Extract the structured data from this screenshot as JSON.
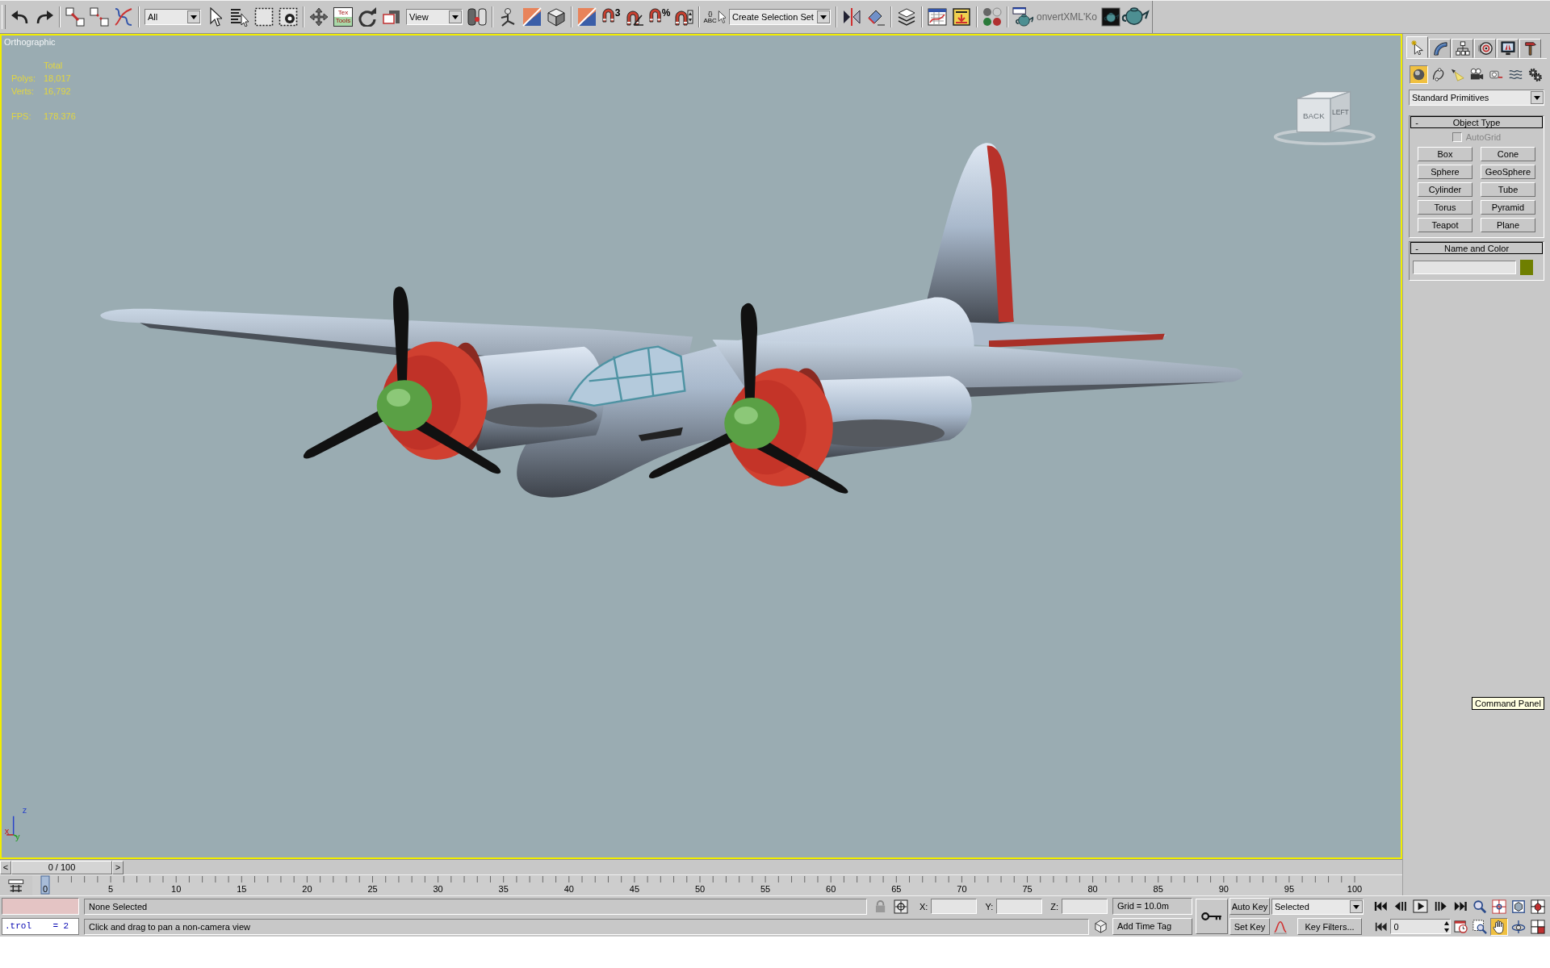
{
  "toolbar": {
    "groups": [
      [
        {
          "kind": "undo"
        },
        {
          "kind": "redo"
        }
      ],
      [
        {
          "kind": "link"
        },
        {
          "kind": "unlink"
        },
        {
          "kind": "bind"
        }
      ],
      [
        {
          "kind": "filter_dropdown",
          "value": "All"
        },
        {
          "kind": "select"
        },
        {
          "kind": "select_by_name"
        },
        {
          "kind": "rect_region"
        },
        {
          "kind": "window_crossing"
        }
      ],
      [
        {
          "kind": "move"
        },
        {
          "kind": "texttools",
          "label": "Tex Tools"
        },
        {
          "kind": "rotate"
        },
        {
          "kind": "scale"
        },
        {
          "kind": "coord_dropdown",
          "value": "View"
        },
        {
          "kind": "pivot"
        }
      ],
      [
        {
          "kind": "manipulate"
        },
        {
          "kind": "shortcut"
        },
        {
          "kind": "box3d"
        }
      ],
      [
        {
          "kind": "snap"
        },
        {
          "kind": "magnet_snap",
          "label": "3"
        },
        {
          "kind": "angle_snap"
        },
        {
          "kind": "magnet_snap",
          "label": "%"
        },
        {
          "kind": "spinner_snap"
        }
      ],
      [
        {
          "kind": "named_sel",
          "label": "{} ABC"
        },
        {
          "kind": "selset_dropdown",
          "value": "Create Selection Set"
        }
      ],
      [
        {
          "kind": "mirror"
        },
        {
          "kind": "align"
        }
      ],
      [
        {
          "kind": "layers"
        }
      ],
      [
        {
          "kind": "curve_editor"
        },
        {
          "kind": "schematic"
        }
      ],
      [
        {
          "kind": "material"
        }
      ],
      [
        {
          "kind": "render_setup"
        },
        {
          "kind": "text_label",
          "label": "onvertXML'Ko"
        },
        {
          "kind": "render_frame"
        },
        {
          "kind": "quick_render"
        }
      ]
    ]
  },
  "viewport": {
    "label": "Orthographic",
    "active": true,
    "stats": {
      "header": "Total",
      "rows": [
        {
          "label": "Polys:",
          "value": "18,017"
        },
        {
          "label": "Verts:",
          "value": "16,792"
        }
      ],
      "fps": {
        "label": "FPS:",
        "value": "178.376"
      }
    },
    "view_cube": {
      "face": "BACK",
      "side": "LEFT"
    },
    "axes": [
      {
        "kind": "z",
        "label": "z"
      },
      {
        "kind": "x",
        "label": "x"
      },
      {
        "kind": "y",
        "label": "y"
      }
    ]
  },
  "command_panel": {
    "tabs": [
      {
        "kind": "create",
        "selected": true
      },
      {
        "kind": "modify",
        "selected": false
      },
      {
        "kind": "hierarchy",
        "selected": false
      },
      {
        "kind": "motion",
        "selected": false
      },
      {
        "kind": "display",
        "selected": false
      },
      {
        "kind": "utilities",
        "selected": false
      }
    ],
    "categories": [
      {
        "kind": "geometry",
        "selected": true
      },
      {
        "kind": "shapes",
        "selected": false
      },
      {
        "kind": "lights",
        "selected": false
      },
      {
        "kind": "cameras",
        "selected": false
      },
      {
        "kind": "helpers",
        "selected": false
      },
      {
        "kind": "spacewarps",
        "selected": false
      },
      {
        "kind": "systems",
        "selected": false
      }
    ],
    "type_dropdown": "Standard Primitives",
    "object_type": {
      "sign": "-",
      "title": "Object Type",
      "autogrid": {
        "label": "AutoGrid",
        "checked": false,
        "disabled": true
      },
      "buttons": [
        "Box",
        "Cone",
        "Sphere",
        "GeoSphere",
        "Cylinder",
        "Tube",
        "Torus",
        "Pyramid",
        "Teapot",
        "Plane"
      ]
    },
    "name_and_color": {
      "sign": "-",
      "title": "Name and Color",
      "color": "#6f7f00"
    }
  },
  "tooltip": "Command Panel",
  "time_slider": {
    "prev": "<",
    "position": "0 / 100",
    "next": ">",
    "level": 0
  },
  "track_bar": {
    "labels": [
      "0",
      "5",
      "10",
      "15",
      "20",
      "25",
      "30",
      "35",
      "40",
      "45",
      "50",
      "55",
      "60",
      "65",
      "70",
      "75",
      "80",
      "85",
      "90",
      "95",
      "100"
    ]
  },
  "status_bar": {
    "listener_output": ".trol    = 2",
    "selection": "None Selected",
    "prompt": "Click and drag to pan a non-camera view",
    "coords": [
      {
        "label": "X:"
      },
      {
        "label": "Y:"
      },
      {
        "label": "Z:"
      }
    ],
    "grid": "Grid = 10.0m",
    "time_tag": "Add Time Tag",
    "auto_key": {
      "label": "Auto Key",
      "on": false
    },
    "set_key": "Set Key",
    "key_set": "Selected",
    "key_filters": "Key Filters...",
    "frame": "0",
    "playback": [
      {
        "kind": "go_start"
      },
      {
        "kind": "prev_frame"
      },
      {
        "kind": "play"
      },
      {
        "kind": "next_frame"
      },
      {
        "kind": "go_end"
      }
    ],
    "nav": [
      {
        "kind": "zoom",
        "selected": false
      },
      {
        "kind": "zoom_all",
        "selected": false
      },
      {
        "kind": "zoom_extents",
        "selected": false
      },
      {
        "kind": "zoom_extents_all",
        "selected": false
      },
      {
        "kind": "region_zoom",
        "selected": false
      },
      {
        "kind": "pan",
        "selected": true
      },
      {
        "kind": "orbit",
        "selected": false
      },
      {
        "kind": "maximize",
        "selected": false
      }
    ]
  }
}
